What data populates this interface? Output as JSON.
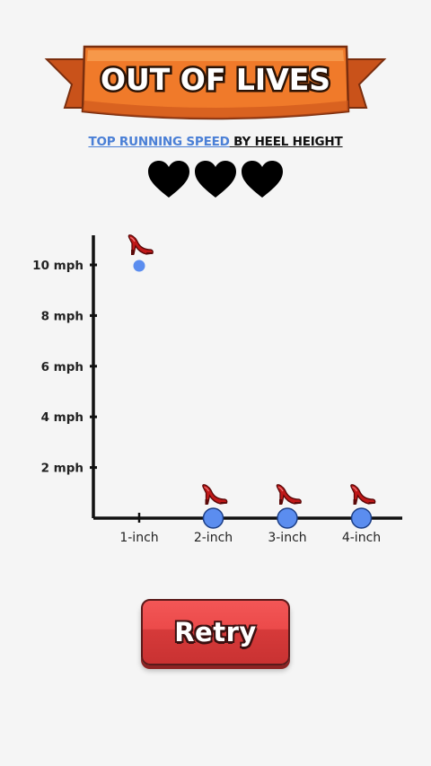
{
  "game": {
    "title": "OUT OF LIVES",
    "subtitle_highlight": "TOP RUNNING SPEED",
    "subtitle_rest": " BY HEEL HEIGHT",
    "lives_total": 3,
    "retry_label": "Retry"
  },
  "colors": {
    "banner": "#f07a2a",
    "banner_dark": "#c9521a",
    "point": "#5b8def",
    "heart": "#000000",
    "retry": "#e84848"
  },
  "chart_data": {
    "type": "scatter",
    "title": "TOP RUNNING SPEED BY HEEL HEIGHT",
    "xlabel": "",
    "ylabel": "",
    "categories": [
      "1-inch",
      "2-inch",
      "3-inch",
      "4-inch"
    ],
    "values": [
      10,
      0,
      0,
      0
    ],
    "ylim": [
      0,
      11
    ],
    "yticks": [
      2,
      4,
      6,
      8,
      10
    ],
    "ytick_labels": [
      "2 mph",
      "4 mph",
      "6 mph",
      "8 mph",
      "10 mph"
    ],
    "grid": false,
    "marker_icon": "high-heel-icon"
  }
}
